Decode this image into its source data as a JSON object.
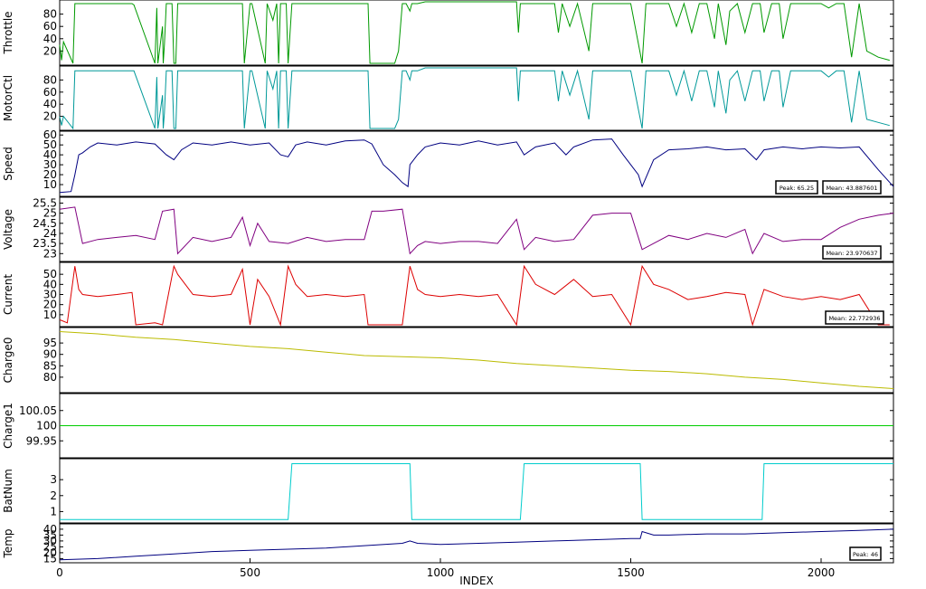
{
  "chart_data": {
    "type": "line",
    "xlabel": "INDEX",
    "xlim": [
      0,
      2190
    ],
    "xticks": [
      0,
      500,
      1000,
      1500,
      2000
    ],
    "xtick_labels": [
      "0",
      "500",
      "1000",
      "1500",
      "2000"
    ],
    "grid": false,
    "panels": [
      {
        "id": "throttle",
        "ylabel": "Throttle",
        "color": "#009900",
        "ylim": [
          0,
          100
        ],
        "yticks": [
          20,
          40,
          60,
          80
        ],
        "ytick_labels": [
          "20",
          "40",
          "60",
          "80"
        ],
        "x": [
          0,
          5,
          10,
          35,
          40,
          60,
          65,
          70,
          190,
          195,
          250,
          255,
          258,
          270,
          272,
          275,
          280,
          295,
          300,
          305,
          310,
          430,
          480,
          485,
          500,
          505,
          540,
          545,
          560,
          570,
          575,
          580,
          595,
          600,
          610,
          810,
          815,
          820,
          880,
          890,
          900,
          910,
          920,
          925,
          940,
          960,
          980,
          1000,
          1010,
          1015,
          1200,
          1205,
          1210,
          1220,
          1250,
          1300,
          1310,
          1320,
          1340,
          1360,
          1390,
          1400,
          1410,
          1450,
          1500,
          1530,
          1540,
          1560,
          1600,
          1620,
          1640,
          1660,
          1680,
          1700,
          1720,
          1730,
          1750,
          1760,
          1780,
          1800,
          1820,
          1840,
          1850,
          1870,
          1890,
          1900,
          1920,
          1960,
          2000,
          2020,
          2040,
          2060,
          2080,
          2100,
          2120,
          2150,
          2180
        ],
        "y": [
          30,
          5,
          35,
          0,
          97,
          97,
          97,
          97,
          97,
          95,
          0,
          90,
          0,
          60,
          0,
          30,
          97,
          97,
          0,
          0,
          97,
          97,
          97,
          0,
          97,
          97,
          0,
          97,
          70,
          97,
          0,
          97,
          97,
          0,
          97,
          97,
          0,
          0,
          0,
          20,
          97,
          97,
          85,
          97,
          97,
          100,
          100,
          100,
          100,
          100,
          100,
          50,
          97,
          97,
          97,
          97,
          50,
          97,
          60,
          97,
          20,
          97,
          97,
          97,
          97,
          0,
          97,
          97,
          97,
          60,
          97,
          50,
          97,
          97,
          40,
          97,
          30,
          85,
          97,
          50,
          97,
          97,
          50,
          97,
          97,
          40,
          97,
          97,
          97,
          90,
          97,
          97,
          10,
          97,
          20,
          10,
          5
        ]
      },
      {
        "id": "motorctl",
        "ylabel": "MotorCtl",
        "color": "#009999",
        "ylim": [
          0,
          100
        ],
        "yticks": [
          20,
          40,
          60,
          80
        ],
        "ytick_labels": [
          "20",
          "40",
          "60",
          "80"
        ],
        "x": [
          0,
          5,
          10,
          35,
          40,
          60,
          65,
          70,
          190,
          195,
          250,
          255,
          258,
          270,
          272,
          275,
          280,
          295,
          300,
          305,
          310,
          430,
          480,
          485,
          500,
          505,
          540,
          545,
          560,
          570,
          575,
          580,
          595,
          600,
          610,
          810,
          815,
          820,
          880,
          890,
          900,
          910,
          920,
          925,
          940,
          960,
          980,
          1000,
          1010,
          1015,
          1200,
          1205,
          1210,
          1220,
          1250,
          1300,
          1310,
          1320,
          1340,
          1360,
          1390,
          1400,
          1410,
          1450,
          1500,
          1530,
          1540,
          1560,
          1600,
          1620,
          1640,
          1660,
          1680,
          1700,
          1720,
          1730,
          1750,
          1760,
          1780,
          1800,
          1820,
          1840,
          1850,
          1870,
          1890,
          1900,
          1920,
          1960,
          2000,
          2020,
          2040,
          2060,
          2080,
          2100,
          2120,
          2150,
          2180
        ],
        "y": [
          20,
          5,
          20,
          0,
          95,
          95,
          95,
          95,
          95,
          95,
          0,
          85,
          0,
          55,
          0,
          25,
          95,
          95,
          0,
          0,
          95,
          95,
          95,
          0,
          95,
          95,
          0,
          95,
          65,
          95,
          0,
          95,
          95,
          0,
          95,
          95,
          0,
          0,
          0,
          15,
          95,
          95,
          80,
          95,
          95,
          100,
          100,
          100,
          100,
          100,
          100,
          45,
          95,
          95,
          95,
          95,
          45,
          95,
          55,
          95,
          15,
          95,
          95,
          95,
          95,
          0,
          95,
          95,
          95,
          55,
          95,
          45,
          95,
          95,
          35,
          95,
          25,
          80,
          95,
          45,
          95,
          95,
          45,
          95,
          95,
          35,
          95,
          95,
          95,
          85,
          95,
          95,
          10,
          95,
          15,
          10,
          5
        ]
      },
      {
        "id": "speed",
        "ylabel": "Speed",
        "color": "#000080",
        "ylim": [
          0,
          62
        ],
        "yticks": [
          10,
          20,
          30,
          40,
          50,
          60
        ],
        "ytick_labels": [
          "10",
          "20",
          "30",
          "40",
          "50",
          "60"
        ],
        "x": [
          0,
          30,
          40,
          50,
          60,
          80,
          100,
          150,
          200,
          250,
          280,
          300,
          320,
          350,
          400,
          450,
          500,
          550,
          580,
          600,
          620,
          650,
          700,
          750,
          800,
          820,
          850,
          880,
          900,
          915,
          920,
          940,
          960,
          1000,
          1050,
          1100,
          1150,
          1200,
          1220,
          1250,
          1300,
          1330,
          1350,
          1400,
          1450,
          1480,
          1500,
          1520,
          1530,
          1560,
          1600,
          1650,
          1700,
          1750,
          1800,
          1830,
          1850,
          1900,
          1950,
          2000,
          2050,
          2100,
          2150,
          2190
        ],
        "y": [
          2,
          3,
          20,
          40,
          42,
          48,
          52,
          50,
          53,
          51,
          40,
          35,
          45,
          52,
          50,
          53,
          50,
          52,
          40,
          38,
          50,
          53,
          50,
          54,
          55,
          51,
          30,
          20,
          12,
          8,
          30,
          40,
          48,
          52,
          50,
          54,
          50,
          53,
          40,
          48,
          52,
          40,
          48,
          55,
          56,
          40,
          30,
          20,
          8,
          35,
          45,
          46,
          48,
          45,
          46,
          35,
          45,
          48,
          46,
          48,
          47,
          48,
          25,
          8
        ]
      },
      {
        "id": "voltage",
        "ylabel": "Voltage",
        "color": "#800080",
        "ylim": [
          22.7,
          25.7
        ],
        "yticks": [
          23,
          23.5,
          24,
          24.5,
          25,
          25.5
        ],
        "ytick_labels": [
          "23",
          "23.5",
          "24",
          "24.5",
          "25",
          "25.5"
        ],
        "x": [
          0,
          40,
          60,
          100,
          150,
          200,
          250,
          270,
          300,
          310,
          350,
          400,
          450,
          480,
          500,
          520,
          550,
          600,
          650,
          700,
          750,
          800,
          820,
          850,
          900,
          920,
          940,
          960,
          1000,
          1050,
          1100,
          1150,
          1200,
          1220,
          1250,
          1300,
          1350,
          1400,
          1450,
          1500,
          1530,
          1560,
          1600,
          1650,
          1700,
          1750,
          1800,
          1820,
          1850,
          1900,
          1950,
          2000,
          2050,
          2100,
          2150,
          2190
        ],
        "y": [
          25.2,
          25.3,
          23.5,
          23.7,
          23.8,
          23.9,
          23.7,
          25.1,
          25.2,
          23,
          23.8,
          23.6,
          23.8,
          24.8,
          23.4,
          24.5,
          23.6,
          23.5,
          23.8,
          23.6,
          23.7,
          23.7,
          25.1,
          25.1,
          25.2,
          23,
          23.4,
          23.6,
          23.5,
          23.6,
          23.6,
          23.5,
          24.7,
          23.2,
          23.8,
          23.6,
          23.7,
          24.9,
          25,
          25,
          23.2,
          23.5,
          23.9,
          23.7,
          24,
          23.8,
          24.2,
          23,
          24,
          23.6,
          23.7,
          23.7,
          24.3,
          24.7,
          24.9,
          25
        ]
      },
      {
        "id": "current",
        "ylabel": "Current",
        "color": "#dd0000",
        "ylim": [
          0,
          60
        ],
        "yticks": [
          10,
          20,
          30,
          40,
          50
        ],
        "ytick_labels": [
          "10",
          "20",
          "30",
          "40",
          "50"
        ],
        "x": [
          0,
          20,
          40,
          50,
          60,
          100,
          150,
          190,
          200,
          250,
          270,
          300,
          310,
          350,
          400,
          450,
          480,
          500,
          520,
          550,
          580,
          600,
          620,
          650,
          700,
          750,
          800,
          810,
          820,
          850,
          900,
          920,
          940,
          960,
          1000,
          1050,
          1100,
          1150,
          1200,
          1220,
          1250,
          1300,
          1350,
          1400,
          1450,
          1500,
          1530,
          1560,
          1600,
          1650,
          1700,
          1750,
          1800,
          1820,
          1850,
          1900,
          1950,
          2000,
          2050,
          2100,
          2150,
          2180
        ],
        "y": [
          5,
          2,
          58,
          35,
          30,
          28,
          30,
          32,
          0,
          2,
          0,
          58,
          50,
          30,
          28,
          30,
          55,
          0,
          45,
          28,
          0,
          58,
          40,
          28,
          30,
          28,
          30,
          0,
          0,
          0,
          0,
          58,
          35,
          30,
          28,
          30,
          28,
          30,
          0,
          58,
          40,
          30,
          45,
          28,
          30,
          0,
          58,
          40,
          35,
          25,
          28,
          32,
          30,
          0,
          35,
          28,
          25,
          28,
          25,
          30,
          0,
          0
        ]
      },
      {
        "id": "charge0",
        "ylabel": "Charge0",
        "color": "#bbbb00",
        "ylim": [
          74,
          101
        ],
        "yticks": [
          80,
          85,
          90,
          95
        ],
        "ytick_labels": [
          "80",
          "85",
          "90",
          "95"
        ],
        "x": [
          0,
          100,
          200,
          300,
          400,
          500,
          600,
          700,
          800,
          900,
          1000,
          1100,
          1200,
          1300,
          1400,
          1500,
          1600,
          1700,
          1800,
          1900,
          2000,
          2100,
          2190
        ],
        "y": [
          100,
          99,
          97.5,
          96.5,
          95,
          93.5,
          92.5,
          91,
          89.5,
          89,
          88.5,
          87.5,
          86,
          85,
          84,
          83,
          82.5,
          81.5,
          80,
          79,
          77.5,
          76,
          75
        ]
      },
      {
        "id": "charge1",
        "ylabel": "Charge1",
        "color": "#00cc00",
        "ylim": [
          99.9,
          100.1
        ],
        "yticks": [
          99.95,
          100,
          100.05
        ],
        "ytick_labels": [
          "99.95",
          "100",
          "100.05"
        ],
        "x": [
          0,
          2190
        ],
        "y": [
          100,
          100
        ]
      },
      {
        "id": "batnum",
        "ylabel": "BatNum",
        "color": "#00cccc",
        "ylim": [
          0.4,
          4.2
        ],
        "yticks": [
          1,
          2,
          3
        ],
        "ytick_labels": [
          "1",
          "2",
          "3"
        ],
        "x": [
          0,
          600,
          610,
          920,
          925,
          1210,
          1220,
          1525,
          1530,
          1845,
          1850,
          2190
        ],
        "y": [
          0.5,
          0.5,
          4,
          4,
          0.5,
          0.5,
          4,
          4,
          0.5,
          0.5,
          4,
          4
        ]
      },
      {
        "id": "temp",
        "ylabel": "Temp",
        "color": "#000080",
        "ylim": [
          13,
          43
        ],
        "yticks": [
          15,
          20,
          25,
          30,
          35,
          40
        ],
        "ytick_labels": [
          "15",
          "20",
          "25",
          "30",
          "35",
          "40"
        ],
        "x": [
          0,
          100,
          200,
          300,
          400,
          500,
          600,
          700,
          800,
          900,
          920,
          940,
          1000,
          1100,
          1200,
          1300,
          1400,
          1500,
          1525,
          1530,
          1560,
          1600,
          1700,
          1800,
          1900,
          2000,
          2100,
          2190
        ],
        "y": [
          14,
          15,
          17,
          19,
          21,
          22,
          23,
          24,
          26,
          28,
          30,
          28,
          27,
          28,
          29,
          30,
          31,
          32,
          32,
          38,
          35,
          35,
          36,
          36,
          37,
          38,
          39,
          40
        ]
      }
    ],
    "annotations": [
      {
        "panel": "speed",
        "text": "Peak: 65.25"
      },
      {
        "panel": "speed",
        "text": "Mean: 43.887601"
      },
      {
        "panel": "voltage",
        "text": "Mean: 23.970637"
      },
      {
        "panel": "current",
        "text": "Mean: 22.772936"
      },
      {
        "panel": "temp",
        "text": "Peak: 46"
      }
    ]
  }
}
